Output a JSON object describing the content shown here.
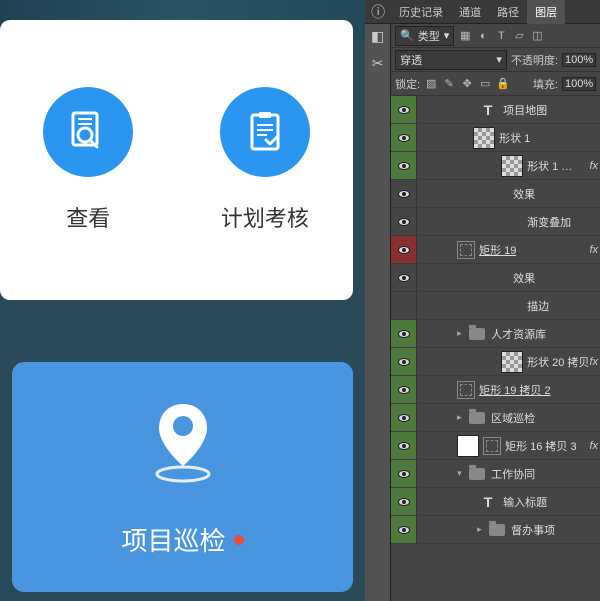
{
  "canvas": {
    "card1_label": "查看",
    "card2_label": "计划考核",
    "big_label": "项目巡检"
  },
  "tabs": {
    "history": "历史记录",
    "channels": "通道",
    "paths": "路径",
    "layers": "图层"
  },
  "filterRow": {
    "kind_label": "类型"
  },
  "blendRow": {
    "mode": "穿透",
    "opacity_label": "不透明度:",
    "opacity_value": "100%"
  },
  "lockRow": {
    "lock_label": "锁定:",
    "fill_label": "填充:",
    "fill_value": "100%"
  },
  "layers": [
    {
      "vis": "green",
      "indent": 60,
      "type": "text",
      "name": "项目地图"
    },
    {
      "vis": "green",
      "indent": 56,
      "type": "checker",
      "name": "形状 1"
    },
    {
      "vis": "green",
      "indent": 72,
      "type": "checker",
      "link": true,
      "name": "形状 1 …",
      "fx": true
    },
    {
      "vis": "empty",
      "indent": 96,
      "type": "sub",
      "eye": true,
      "name": "效果"
    },
    {
      "vis": "empty",
      "indent": 110,
      "type": "sub",
      "eye": true,
      "name": "渐变叠加"
    },
    {
      "vis": "red",
      "indent": 40,
      "type": "vmask",
      "name": "矩形 19",
      "ul": true,
      "fx": true
    },
    {
      "vis": "empty",
      "indent": 96,
      "type": "sub",
      "eye": true,
      "name": "效果"
    },
    {
      "vis": "empty",
      "indent": 110,
      "type": "sub",
      "name": "描边"
    },
    {
      "vis": "green",
      "indent": 40,
      "type": "folder",
      "chev": ">",
      "name": "人才资源库"
    },
    {
      "vis": "green",
      "indent": 72,
      "type": "checker",
      "link": true,
      "name": "形状 20 拷贝",
      "fx": true
    },
    {
      "vis": "green",
      "indent": 40,
      "type": "vmask",
      "name": "矩形 19 拷贝 2",
      "ul": true
    },
    {
      "vis": "green",
      "indent": 40,
      "type": "folder",
      "chev": ">",
      "name": "区域巡检"
    },
    {
      "vis": "green",
      "indent": 40,
      "type": "white",
      "vmask2": true,
      "name": "矩形 16 拷贝 3",
      "fx": true
    },
    {
      "vis": "green",
      "indent": 40,
      "type": "folder",
      "chev": "v",
      "name": "工作协同"
    },
    {
      "vis": "green",
      "indent": 60,
      "type": "text",
      "name": "输入标题"
    },
    {
      "vis": "green",
      "indent": 60,
      "type": "folder",
      "chev": ">",
      "name": "督办事项"
    }
  ]
}
